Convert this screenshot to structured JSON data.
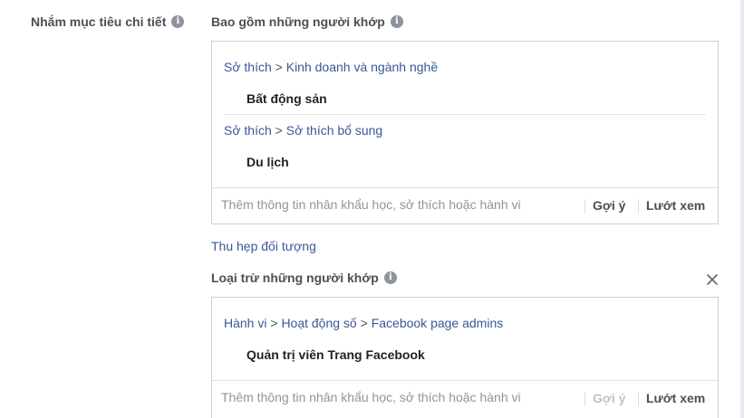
{
  "detailed_targeting": {
    "label": "Nhắm mục tiêu chi tiết"
  },
  "include": {
    "title": "Bao gồm những người khớp",
    "groups": [
      {
        "path": [
          "Sở thích",
          "Kinh doanh và ngành nghề"
        ],
        "items": [
          "Bất động sản"
        ]
      },
      {
        "path": [
          "Sở thích",
          "Sở thích bổ sung"
        ],
        "items": [
          "Du lịch"
        ]
      }
    ],
    "input_placeholder": "Thêm thông tin nhân khẩu học, sở thích hoặc hành vi",
    "suggest_label": "Gợi ý",
    "browse_label": "Lướt xem"
  },
  "narrow_link": "Thu hẹp đối tượng",
  "exclude": {
    "title": "Loại trừ những người khớp",
    "groups": [
      {
        "path": [
          "Hành vi",
          "Hoạt động số",
          "Facebook page admins"
        ],
        "items": [
          "Quản trị viên Trang Facebook"
        ]
      }
    ],
    "input_placeholder": "Thêm thông tin nhân khẩu học, sở thích hoặc hành vi",
    "suggest_label": "Gợi ý",
    "browse_label": "Lướt xem"
  },
  "breadcrumb_separator": ">",
  "info_glyph": "i",
  "icons": {
    "info": "info-icon",
    "close": "close-icon"
  },
  "colors": {
    "link_blue": "#385898",
    "label_gray": "#4b4f56",
    "border": "#ccd0d5",
    "disabled_text": "#bec3c9",
    "icon_gray": "#8d949e"
  }
}
